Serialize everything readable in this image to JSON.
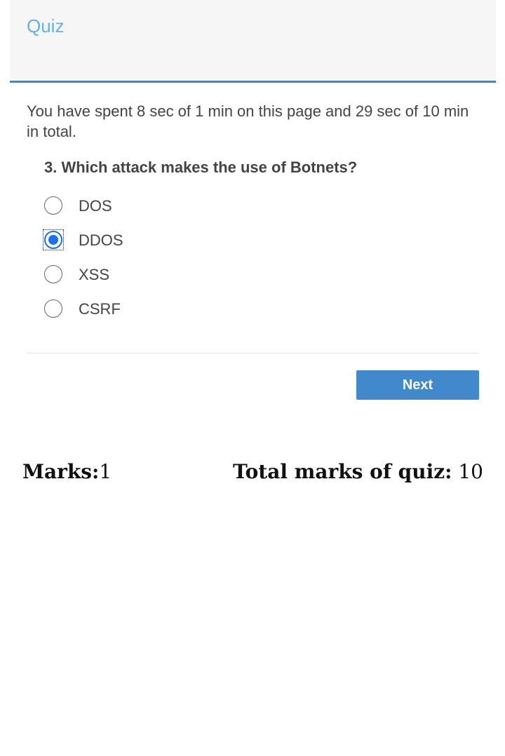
{
  "header": {
    "title": "Quiz"
  },
  "timer": {
    "text": "You have spent 8 sec of 1 min on this page and 29 sec of 10 min in total."
  },
  "question": {
    "text": "3. Which attack makes the use of Botnets?",
    "options": [
      {
        "label": "DOS",
        "selected": false
      },
      {
        "label": "DDOS",
        "selected": true
      },
      {
        "label": "XSS",
        "selected": false
      },
      {
        "label": "CSRF",
        "selected": false
      }
    ]
  },
  "navigation": {
    "next_label": "Next"
  },
  "footer": {
    "marks_label": "Marks:",
    "marks_value": "1",
    "total_label": "Total marks of quiz:",
    "total_value": "10"
  },
  "colors": {
    "accent": "#4189cc",
    "header_title": "#6ab0e3",
    "radio_selected": "#1a73e8"
  }
}
